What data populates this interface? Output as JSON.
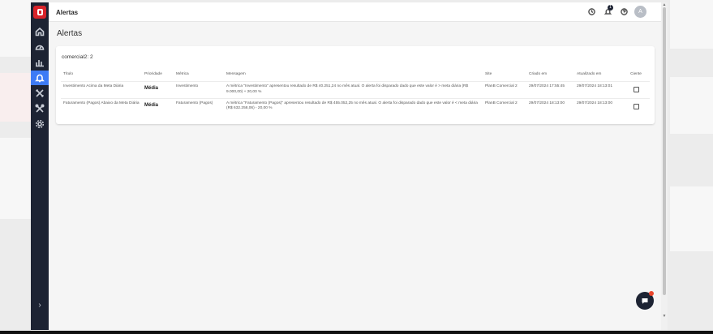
{
  "window": {
    "title": "Alertas"
  },
  "header": {
    "page_title": "Alertas",
    "notification_count": "1",
    "avatar_initial": "A"
  },
  "sidebar": {
    "items": [
      {
        "name": "home",
        "icon": "home-icon",
        "active": false
      },
      {
        "name": "dashboard",
        "icon": "gauge-icon",
        "active": false
      },
      {
        "name": "reports",
        "icon": "bar-chart-icon",
        "active": false
      },
      {
        "name": "alerts",
        "icon": "bell-icon",
        "active": true
      },
      {
        "name": "tools",
        "icon": "tools-icon",
        "active": false
      },
      {
        "name": "integrations",
        "icon": "crossed-tools-icon",
        "active": false
      },
      {
        "name": "settings",
        "icon": "gear-icon",
        "active": false
      }
    ],
    "expand_label": "›"
  },
  "card": {
    "title": "comercial2: 2",
    "columns": [
      "Título",
      "Prioridade",
      "Métrica",
      "Mensagem",
      "Site",
      "Criado em",
      "Atualizado em",
      "Ciente"
    ],
    "rows": [
      {
        "titulo": "Investimento Acima da Meta Diária",
        "prioridade": "Média",
        "metrica": "Investimento",
        "mensagem": "A métrica \"Investimento\" apresentou resultado de R$ 40.251,24 no mês atual. O alerta foi disparado dado que este valor é > meta diária (R$ 9.000,00) + 20,00 %",
        "site": "PlanB Comercial 2",
        "criado_em": "29/07/2024 17:55:45",
        "atualizado_em": "29/07/2024 18:13:01"
      },
      {
        "titulo": "Faturamento (Pagos) Abaixo da Meta Diária",
        "prioridade": "Média",
        "metrica": "Faturamento (Pagos)",
        "mensagem": "A métrica \"Faturamento (Pagos)\" apresentou resultado de R$ 455.052,25 no mês atual. O alerta foi disparado dado que este valor é < meta diária (R$ 632.258,06) - 20,00 %",
        "site": "PlanB Comercial 2",
        "criado_em": "29/07/2024 18:13:00",
        "atualizado_em": "29/07/2024 18:13:00"
      }
    ]
  },
  "colors": {
    "sidebar_bg": "#1d2333",
    "accent": "#3d7bf5",
    "brand": "#d8232a",
    "chat_dot": "#e9452c"
  }
}
